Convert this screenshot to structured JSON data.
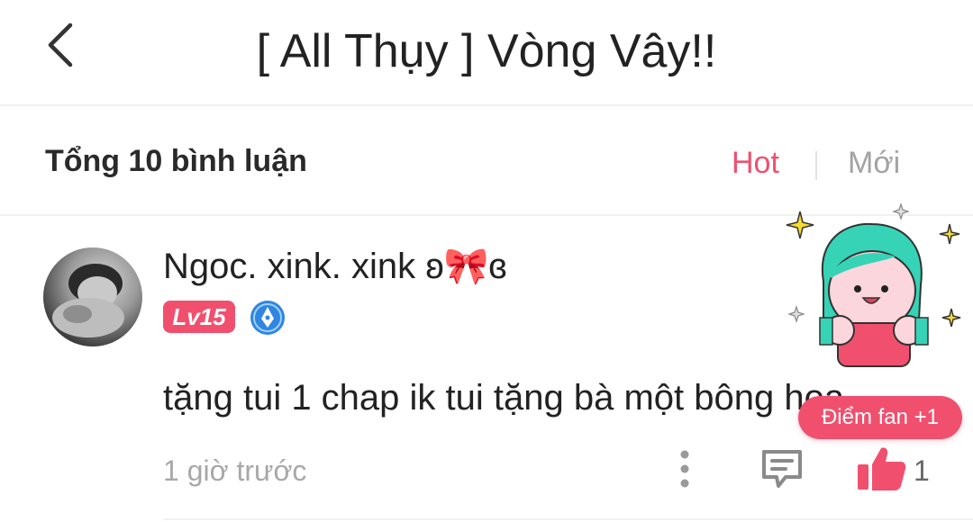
{
  "header": {
    "back_icon": "chevron-left-icon",
    "title": "[ All Thụy ] Vòng Vây!!"
  },
  "subbar": {
    "total_label": "Tổng 10 bình luận",
    "sort_hot": "Hot",
    "sort_new": "Mới",
    "active_sort": "Hot"
  },
  "comment": {
    "username": "Ngoc. xink. xink ʚ🎀ɞ",
    "level": "Lv15",
    "text": "tặng tui 1 chap ik tui tặng bà một bông hoa",
    "time": "1 giờ trước",
    "likes": "1",
    "fan_points": "Điểm fan +1",
    "icons": [
      "more-vertical-icon",
      "reply-comment-icon",
      "thumbs-up-icon",
      "pen-badge-icon",
      "mascot-sticker"
    ]
  },
  "colors": {
    "accent": "#f0506e",
    "muted": "#a8a8a8",
    "badge_blue": "#2f86e0"
  }
}
